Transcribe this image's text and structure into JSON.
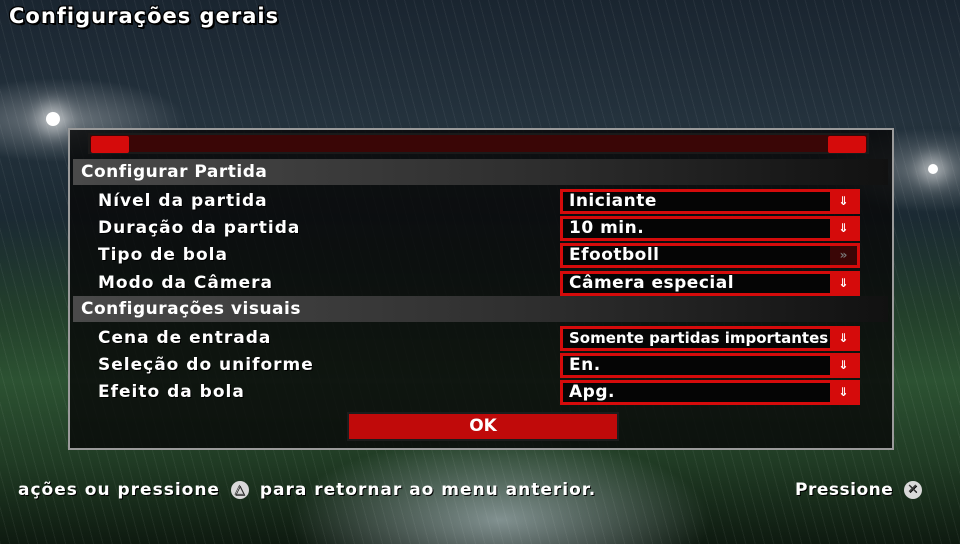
{
  "screen": {
    "title": "Configurações gerais"
  },
  "colors": {
    "accent": "#d50b0b",
    "panel": "#080808",
    "bar_track": "#3a0606"
  },
  "sections": [
    {
      "label": "Configurar Partida"
    },
    {
      "label": "Configurações visuais"
    }
  ],
  "settings": [
    {
      "label": "Nível da partida",
      "value": "Iniciante",
      "arrow_icon": "double-chevron-down-icon"
    },
    {
      "label": "Duração da partida",
      "value": "10 min.",
      "arrow_icon": "double-chevron-down-icon"
    },
    {
      "label": "Tipo de bola",
      "value": "Efootboll",
      "arrow_icon": "double-chevron-right-icon"
    },
    {
      "label": "Modo da Câmera",
      "value": "Câmera especial",
      "arrow_icon": "double-chevron-down-icon"
    },
    {
      "label": "Cena de entrada",
      "value": "Somente partidas importantes",
      "arrow_icon": "double-chevron-down-icon"
    },
    {
      "label": "Seleção do uniforme",
      "value": "En.",
      "arrow_icon": "double-chevron-down-icon"
    },
    {
      "label": "Efeito da bola",
      "value": "Apg.",
      "arrow_icon": "double-chevron-down-icon"
    }
  ],
  "ok_button": {
    "label": "OK"
  },
  "footer": {
    "left_text_a": "ações ou pressione",
    "left_glyph": "△",
    "left_text_b": "para retornar ao menu anterior.",
    "right_text": "Pressione",
    "right_glyph": "✕"
  }
}
